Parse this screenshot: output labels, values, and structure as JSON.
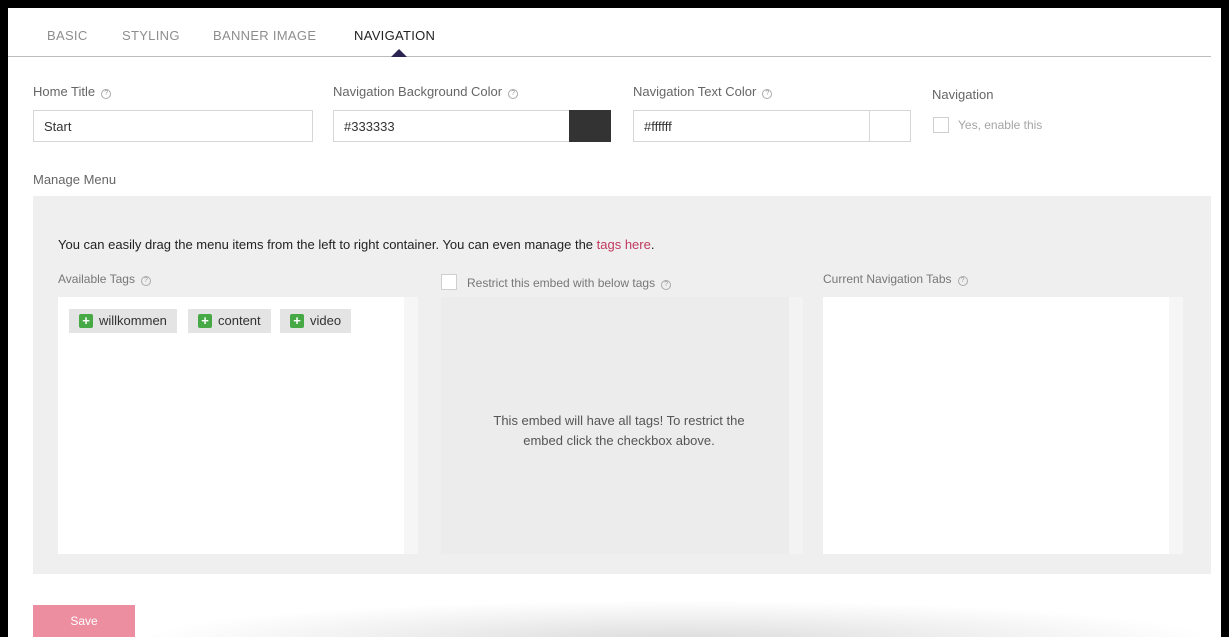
{
  "tabs": [
    {
      "label": "BASIC"
    },
    {
      "label": "STYLING"
    },
    {
      "label": "BANNER IMAGE"
    },
    {
      "label": "NAVIGATION"
    }
  ],
  "active_tab": "NAVIGATION",
  "fields": {
    "home_title": {
      "label": "Home Title",
      "value": "Start"
    },
    "nav_bg_color": {
      "label": "Navigation Background Color",
      "value": "#333333",
      "swatch": "#333333"
    },
    "nav_text_color": {
      "label": "Navigation Text Color",
      "value": "#ffffff",
      "swatch": "#ffffff"
    },
    "navigation": {
      "label": "Navigation",
      "checkbox_label": "Yes, enable this",
      "checked": false
    }
  },
  "manage_menu": {
    "title": "Manage Menu",
    "instruction_text": "You can easily drag the menu items from the left to right container. You can even manage the ",
    "instruction_link": "tags here",
    "instruction_end": ".",
    "available_label": "Available Tags",
    "available_tags": [
      "willkommen",
      "content",
      "video"
    ],
    "restrict_label": "Restrict this embed with below tags",
    "restrict_message_line1": "This embed will have all tags! To restrict the",
    "restrict_message_line2": "embed click the checkbox above.",
    "current_label": "Current Navigation Tabs"
  },
  "save_label": "Save",
  "colors": {
    "accent": "#2b2350",
    "link": "#c0395e",
    "save": "#ec8da0",
    "tag_plus": "#47a846"
  }
}
